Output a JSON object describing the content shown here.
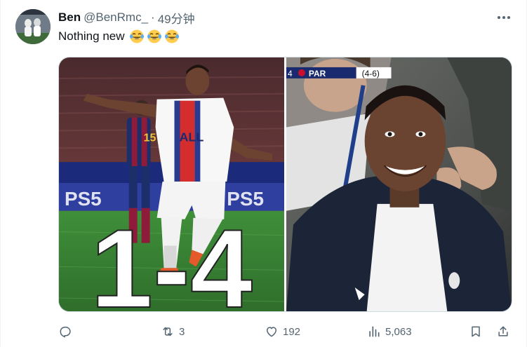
{
  "tweet": {
    "display_name": "Ben",
    "handle": "@BenRmc_",
    "separator": "·",
    "time": "49分钟",
    "text": "Nothing new",
    "emojis": [
      "face-with-tears-of-joy",
      "face-with-tears-of-joy",
      "face-with-tears-of-joy"
    ],
    "media": {
      "left": {
        "score_text": "1-4",
        "ad_board_text": "PS5",
        "jersey_number": "15",
        "shirt_text": "ALL"
      },
      "right": {
        "scorebug": {
          "prefix": "4",
          "team": "PAR",
          "score": "(4-6)"
        }
      }
    },
    "actions": {
      "reply_count": "",
      "retweet_count": "3",
      "like_count": "192",
      "views_count": "5,063"
    }
  },
  "colors": {
    "text_primary": "#0f1419",
    "text_secondary": "#536471",
    "border": "#cfd9de"
  },
  "icons": {
    "more": "more-horizontal-icon",
    "reply": "reply-icon",
    "retweet": "retweet-icon",
    "like": "heart-icon",
    "views": "analytics-icon",
    "bookmark": "bookmark-icon",
    "share": "share-icon"
  }
}
